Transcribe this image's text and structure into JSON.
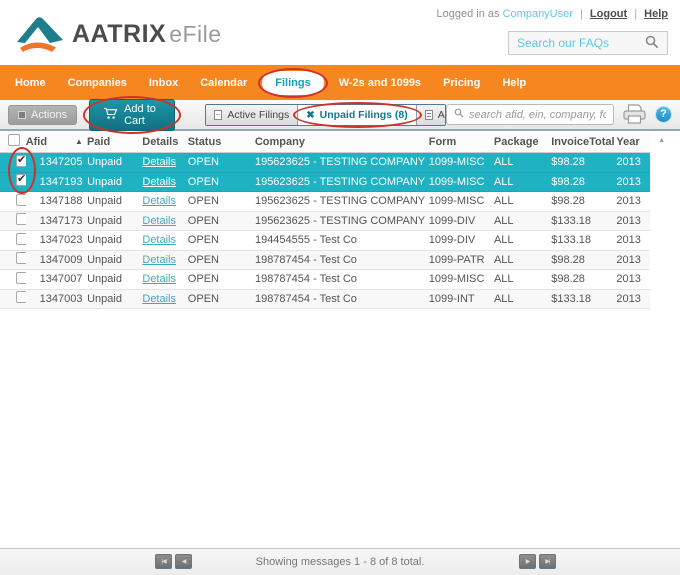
{
  "header": {
    "brand": "AATRIX",
    "product": "eFile",
    "logged_in_prefix": "Logged in as",
    "username": "CompanyUser",
    "separator": "|",
    "logout_label": "Logout",
    "help_label": "Help",
    "faq_search_label": "Search our FAQs"
  },
  "nav": {
    "items": [
      {
        "label": "Home",
        "active": false
      },
      {
        "label": "Companies",
        "active": false
      },
      {
        "label": "Inbox",
        "active": false
      },
      {
        "label": "Calendar",
        "active": false
      },
      {
        "label": "Filings",
        "active": true
      },
      {
        "label": "W-2s and 1099s",
        "active": false
      },
      {
        "label": "Pricing",
        "active": false
      },
      {
        "label": "Help",
        "active": false
      }
    ]
  },
  "toolbar": {
    "actions_label": "Actions",
    "add_to_cart_label": "Add to Cart",
    "filters": [
      {
        "label": "Active Filings",
        "icon": "document-icon",
        "active": false
      },
      {
        "label": "Unpaid Filings (8)",
        "icon": "x-icon",
        "active": true
      },
      {
        "label": "Archived Filings",
        "icon": "archive-icon",
        "active": false
      }
    ],
    "search_placeholder": "search afid, ein, company, form, year"
  },
  "table": {
    "columns": {
      "afid": "Afid",
      "paid": "Paid",
      "details": "Details",
      "status": "Status",
      "company": "Company",
      "form": "Form",
      "package": "Package",
      "invoice_total": "InvoiceTotal",
      "year": "Year"
    },
    "sort": {
      "column": "Afid",
      "direction": "asc",
      "indicator": "▲"
    },
    "rows": [
      {
        "afid": "1347205",
        "paid": "Unpaid",
        "details_label": "Details",
        "status": "OPEN",
        "company": "195623625 - TESTING COMPANY",
        "form": "1099-MISC",
        "package": "ALL",
        "invoice_total": "$98.28",
        "year": "2013",
        "selected": true
      },
      {
        "afid": "1347193",
        "paid": "Unpaid",
        "details_label": "Details",
        "status": "OPEN",
        "company": "195623625 - TESTING COMPANY",
        "form": "1099-MISC",
        "package": "ALL",
        "invoice_total": "$98.28",
        "year": "2013",
        "selected": true
      },
      {
        "afid": "1347188",
        "paid": "Unpaid",
        "details_label": "Details",
        "status": "OPEN",
        "company": "195623625 - TESTING COMPANY",
        "form": "1099-MISC",
        "package": "ALL",
        "invoice_total": "$98.28",
        "year": "2013",
        "selected": false
      },
      {
        "afid": "1347173",
        "paid": "Unpaid",
        "details_label": "Details",
        "status": "OPEN",
        "company": "195623625 - TESTING COMPANY",
        "form": "1099-DIV",
        "package": "ALL",
        "invoice_total": "$133.18",
        "year": "2013",
        "selected": false
      },
      {
        "afid": "1347023",
        "paid": "Unpaid",
        "details_label": "Details",
        "status": "OPEN",
        "company": "194454555 - Test Co",
        "form": "1099-DIV",
        "package": "ALL",
        "invoice_total": "$133.18",
        "year": "2013",
        "selected": false
      },
      {
        "afid": "1347009",
        "paid": "Unpaid",
        "details_label": "Details",
        "status": "OPEN",
        "company": "198787454 - Test Co",
        "form": "1099-PATR",
        "package": "ALL",
        "invoice_total": "$98.28",
        "year": "2013",
        "selected": false
      },
      {
        "afid": "1347007",
        "paid": "Unpaid",
        "details_label": "Details",
        "status": "OPEN",
        "company": "198787454 - Test Co",
        "form": "1099-MISC",
        "package": "ALL",
        "invoice_total": "$98.28",
        "year": "2013",
        "selected": false
      },
      {
        "afid": "1347003",
        "paid": "Unpaid",
        "details_label": "Details",
        "status": "OPEN",
        "company": "198787454 - Test Co",
        "form": "1099-INT",
        "package": "ALL",
        "invoice_total": "$133.18",
        "year": "2013",
        "selected": false
      }
    ]
  },
  "footer": {
    "status_text": "Showing messages 1 - 8 of 8 total.",
    "pager_first": "|◀",
    "pager_prev": "◀",
    "pager_next": "▶",
    "pager_last": "▶|"
  },
  "icons": {
    "faq_search": "search-icon",
    "toolbar_search": "search-icon",
    "actions": "box-icon",
    "add_to_cart": "cart-icon",
    "print": "printer-icon",
    "help": "question-icon",
    "sort": "triangle-up-icon",
    "scroll_up": "triangle-up-icon"
  },
  "annotations": {
    "color": "#cc332b",
    "circled": [
      "filings-nav-tab",
      "add-to-cart-button",
      "unpaid-filings-filter",
      "selected-row-checkboxes"
    ]
  },
  "colors": {
    "nav_orange": "#f6861f",
    "selected_row_teal": "#1fb2c3",
    "button_teal": "#178799",
    "link_teal": "#3fa9bc",
    "light_blue": "#5bc8e8",
    "annotation_red": "#cc332b"
  }
}
